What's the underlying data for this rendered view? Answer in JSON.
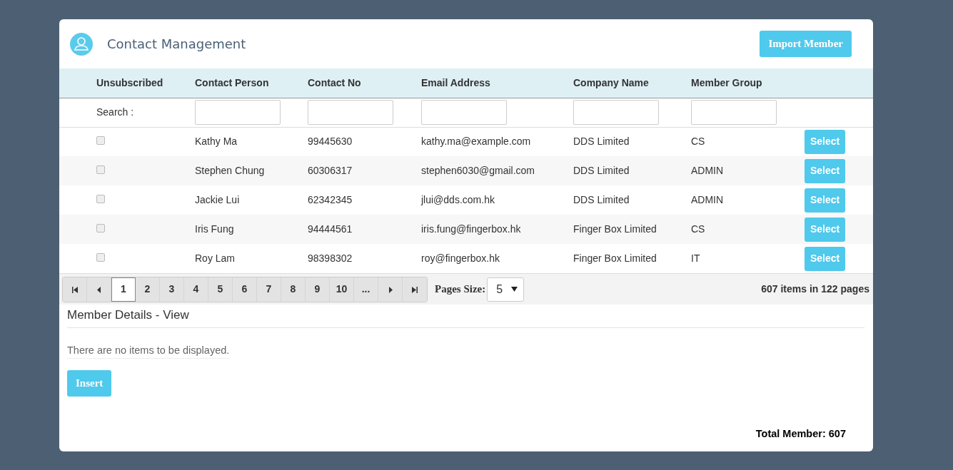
{
  "header": {
    "title": "Contact Management",
    "import_button": "Import Member"
  },
  "table": {
    "columns": [
      "Unsubscribed",
      "Contact Person",
      "Contact No",
      "Email Address",
      "Company Name",
      "Member Group"
    ],
    "search_label": "Search :",
    "rows": [
      {
        "unsubscribed": false,
        "disabled": true,
        "contact_person": "Kathy Ma",
        "contact_no": "99445630",
        "email": "kathy.ma@example.com",
        "company": "DDS Limited",
        "group": "CS",
        "action": "Select"
      },
      {
        "unsubscribed": false,
        "disabled": true,
        "contact_person": "Stephen Chung",
        "contact_no": "60306317",
        "email": "stephen6030@gmail.com",
        "company": "DDS Limited",
        "group": "ADMIN",
        "action": "Select"
      },
      {
        "unsubscribed": false,
        "disabled": true,
        "contact_person": "Jackie Lui",
        "contact_no": "62342345",
        "email": "jlui@dds.com.hk",
        "company": "DDS Limited",
        "group": "ADMIN",
        "action": "Select"
      },
      {
        "unsubscribed": false,
        "disabled": true,
        "contact_person": "Iris Fung",
        "contact_no": "94444561",
        "email": "iris.fung@fingerbox.hk",
        "company": "Finger Box Limited",
        "group": "CS",
        "action": "Select"
      },
      {
        "unsubscribed": false,
        "disabled": true,
        "contact_person": "Roy Lam",
        "contact_no": "98398302",
        "email": "roy@fingerbox.hk",
        "company": "Finger Box Limited",
        "group": "IT",
        "action": "Select"
      }
    ]
  },
  "pager": {
    "pages": [
      {
        "label": "1",
        "selected": true
      },
      {
        "label": "2",
        "selected": false
      },
      {
        "label": "3",
        "selected": false
      },
      {
        "label": "4",
        "selected": false
      },
      {
        "label": "5",
        "selected": false
      },
      {
        "label": "6",
        "selected": false
      },
      {
        "label": "7",
        "selected": false
      },
      {
        "label": "8",
        "selected": false
      },
      {
        "label": "9",
        "selected": false
      },
      {
        "label": "10",
        "selected": false
      },
      {
        "label": "...",
        "selected": false
      }
    ],
    "page_size_label": "Pages Size:",
    "page_size": "5",
    "summary": "607 items in 122 pages"
  },
  "details": {
    "title": "Member Details - View",
    "empty_message": "There are no items to be displayed.",
    "insert_button": "Insert",
    "total": "Total Member: 607"
  }
}
